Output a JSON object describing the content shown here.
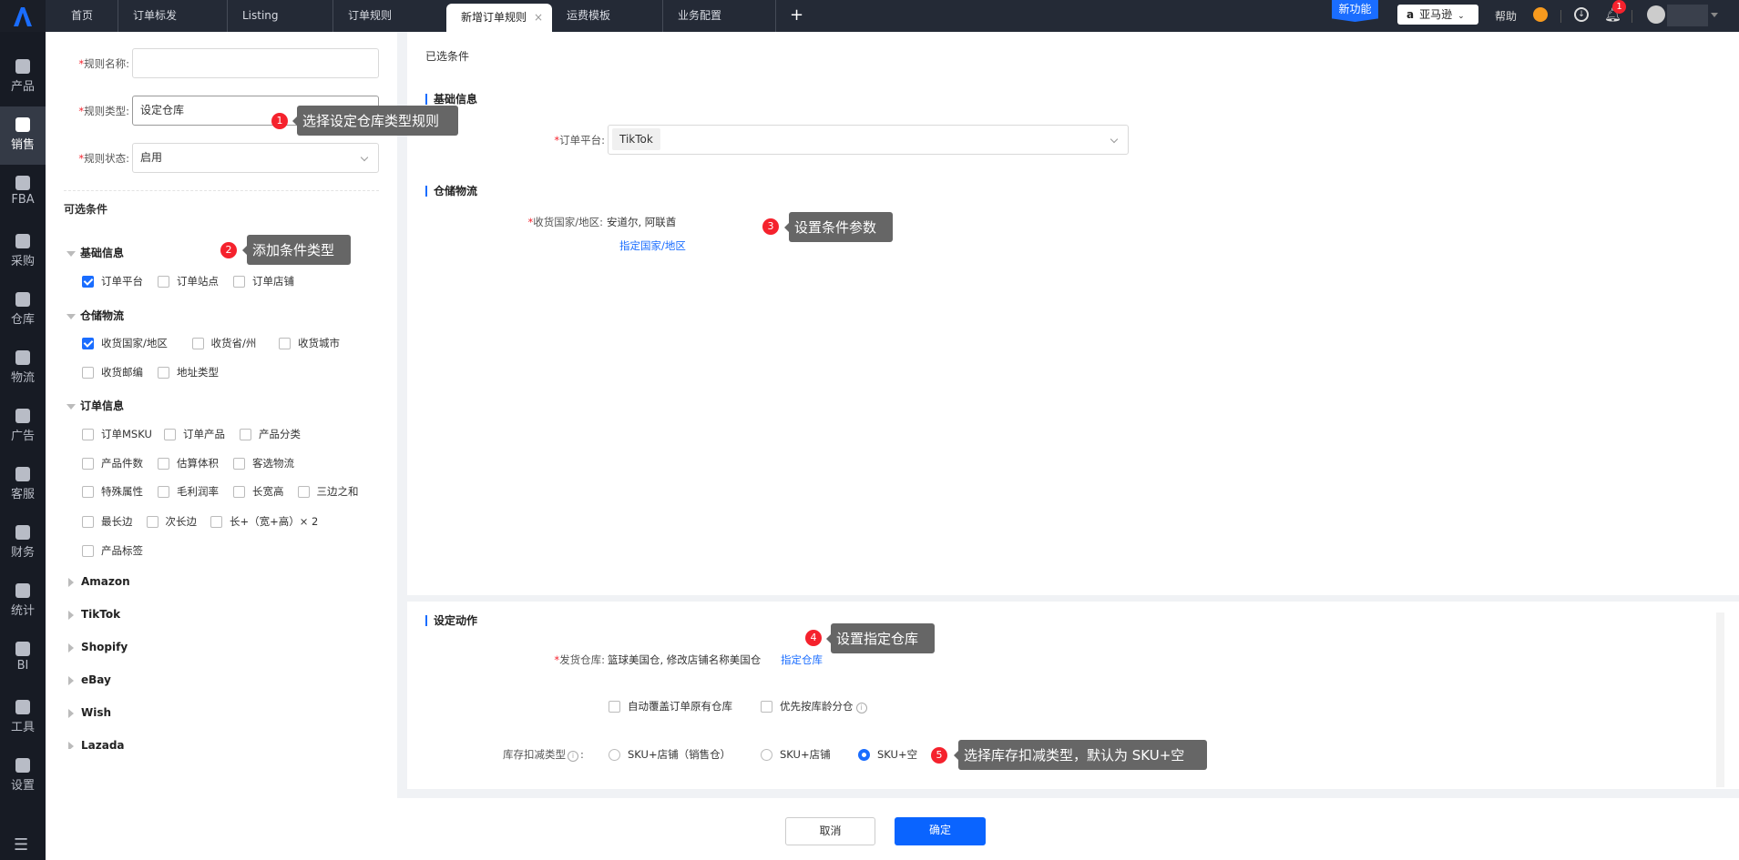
{
  "topbar": {
    "tabs": [
      {
        "label": "首页"
      },
      {
        "label": "订单标发"
      },
      {
        "label": "Listing"
      },
      {
        "label": "订单规则"
      },
      {
        "label": "新增订单规则",
        "active": true
      },
      {
        "label": "运费模板"
      },
      {
        "label": "业务配置"
      }
    ],
    "add_tab": "+",
    "close_tab": "×",
    "new_feature": "新功能",
    "platform_select": "亚马逊",
    "help": "帮助",
    "notification_count": "1"
  },
  "sidebar": {
    "items": [
      {
        "label": "产品",
        "icon": "bag-icon"
      },
      {
        "label": "销售",
        "icon": "sell-icon",
        "active": true
      },
      {
        "label": "FBA",
        "icon": "amazon-icon"
      },
      {
        "label": "采购",
        "icon": "cart-icon"
      },
      {
        "label": "仓库",
        "icon": "warehouse-icon"
      },
      {
        "label": "物流",
        "icon": "truck-icon"
      },
      {
        "label": "广告",
        "icon": "ad-icon"
      },
      {
        "label": "客服",
        "icon": "mail-icon"
      },
      {
        "label": "财务",
        "icon": "yen-icon"
      },
      {
        "label": "统计",
        "icon": "pie-icon"
      },
      {
        "label": "BI",
        "icon": "chart-icon"
      },
      {
        "label": "工具",
        "icon": "wrench-icon"
      },
      {
        "label": "设置",
        "icon": "gear-icon"
      }
    ]
  },
  "left": {
    "rule_name_label": "规则名称:",
    "rule_name_value": "",
    "rule_type_label": "规则类型:",
    "rule_type_value": "设定仓库",
    "rule_status_label": "规则状态:",
    "rule_status_value": "启用",
    "optional_title": "可选条件",
    "groups": [
      {
        "title": "基础信息",
        "options": [
          {
            "label": "订单平台",
            "checked": true
          },
          {
            "label": "订单站点",
            "checked": false
          },
          {
            "label": "订单店铺",
            "checked": false
          }
        ]
      },
      {
        "title": "仓储物流",
        "options": [
          {
            "label": "收货国家/地区",
            "checked": true
          },
          {
            "label": "收货省/州",
            "checked": false
          },
          {
            "label": "收货城市",
            "checked": false
          },
          {
            "label": "收货邮编",
            "checked": false
          },
          {
            "label": "地址类型",
            "checked": false
          }
        ]
      },
      {
        "title": "订单信息",
        "options": [
          {
            "label": "订单MSKU"
          },
          {
            "label": "订单产品"
          },
          {
            "label": "产品分类"
          },
          {
            "label": "产品件数"
          },
          {
            "label": "估算体积"
          },
          {
            "label": "客选物流"
          },
          {
            "label": "特殊属性"
          },
          {
            "label": "毛利润率"
          },
          {
            "label": "长宽高"
          },
          {
            "label": "三边之和"
          },
          {
            "label": "最长边"
          },
          {
            "label": "次长边"
          },
          {
            "label": "长+（宽+高）× 2"
          },
          {
            "label": "产品标签"
          }
        ]
      }
    ],
    "collapsed": [
      "Amazon",
      "TikTok",
      "Shopify",
      "eBay",
      "Wish",
      "Lazada"
    ]
  },
  "right": {
    "selected_title": "已选条件",
    "basic_title": "基础信息",
    "platform_label": "订单平台:",
    "platform_tag": "TikTok",
    "storage_title": "仓储物流",
    "country_label": "收货国家/地区:",
    "country_value": "安道尔, 阿联酋",
    "country_link": "指定国家/地区",
    "action_title": "设定动作",
    "warehouse_label": "发货仓库:",
    "warehouse_value": "篮球美国仓, 修改店铺名称美国仓",
    "warehouse_link": "指定仓库",
    "override_label": "自动覆盖订单原有仓库",
    "age_label": "优先按库龄分仓",
    "deduct_label": "库存扣减类型",
    "deduct_options": [
      {
        "label": "SKU+店铺（销售仓）",
        "selected": false
      },
      {
        "label": "SKU+店铺",
        "selected": false
      },
      {
        "label": "SKU+空",
        "selected": true
      }
    ]
  },
  "tips": [
    {
      "n": "1",
      "text": "选择设定仓库类型规则"
    },
    {
      "n": "2",
      "text": "添加条件类型"
    },
    {
      "n": "3",
      "text": "设置条件参数"
    },
    {
      "n": "4",
      "text": "设置指定仓库"
    },
    {
      "n": "5",
      "text": "选择库存扣减类型，默认为 SKU+空"
    }
  ],
  "footer": {
    "cancel": "取消",
    "confirm": "确定"
  },
  "colors": {
    "primary": "#1a6dff",
    "topbar": "#242a36",
    "sidebar": "#171b24",
    "badge": "#f5222d"
  }
}
